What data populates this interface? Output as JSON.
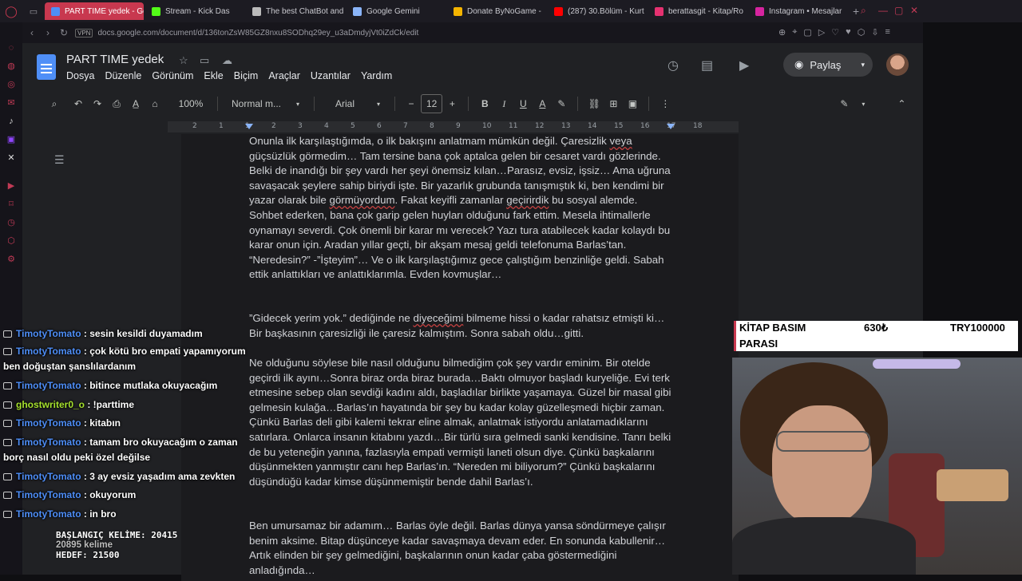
{
  "browser": {
    "tabs": [
      {
        "label": "PART TIME yedek - Goog",
        "color": "#4f8ff7",
        "active": true
      },
      {
        "label": "Stream - Kick Das",
        "color": "#53fc18",
        "active": false
      },
      {
        "label": "The best ChatBot and",
        "color": "#bbbbbb",
        "active": false
      },
      {
        "label": "Google Gemini",
        "color": "#8ab4f8",
        "active": false
      },
      {
        "label": "Donate ByNoGame -",
        "color": "#f4b400",
        "active": false
      },
      {
        "label": "(287) 30.Bölüm - Kurt",
        "color": "#ff0000",
        "active": false
      },
      {
        "label": "berattasgit - Kitap/Ro",
        "color": "#e53170",
        "active": false
      },
      {
        "label": "Instagram • Mesajlar",
        "color": "#d6249f",
        "active": false
      }
    ],
    "vpn": "VPN",
    "url": "docs.google.com/document/d/136tonZsW85GZ8nxu8SODhq29ey_u3aDmdyjVt0iZdCk/edit"
  },
  "docs": {
    "title": "PART TIME  yedek",
    "menus": [
      "Dosya",
      "Düzenle",
      "Görünüm",
      "Ekle",
      "Biçim",
      "Araçlar",
      "Uzantılar",
      "Yardım"
    ],
    "share_label": "Paylaş",
    "zoom": "100%",
    "style": "Normal m...",
    "font": "Arial",
    "font_size": "12",
    "ruler": [
      "2",
      "1",
      "1",
      "2",
      "3",
      "4",
      "5",
      "6",
      "7",
      "8",
      "9",
      "10",
      "11",
      "12",
      "13",
      "14",
      "15",
      "16",
      "17",
      "18"
    ]
  },
  "document": {
    "p1_parts": [
      {
        "t": "Onunla ilk karşılaştığımda, o ilk bakışını anlatmam mümkün değil. Çaresizlik ",
        "sq": false
      },
      {
        "t": "veya",
        "sq": true
      },
      {
        "t": " güçsüzlük görmedim… Tam tersine bana çok aptalca gelen bir cesaret vardı gözlerinde. Belki de inandığı bir şey vardı her şeyi önemsiz kılan…Parasız, evsiz, işsiz… Ama uğruna savaşacak şeylere sahip biriydi işte. Bir yazarlık grubunda tanışmıştık ki, ben kendimi bir yazar olarak bile ",
        "sq": false
      },
      {
        "t": "görmüyordum",
        "sq": true
      },
      {
        "t": ". Fakat keyifli zamanlar ",
        "sq": false
      },
      {
        "t": "geçirirdik",
        "sq": true
      },
      {
        "t": " bu sosyal alemde. Sohbet ederken, bana çok garip gelen huyları olduğunu fark ettim. Mesela ihtimallerle oynamayı severdi. Çok önemli bir karar mı verecek? Yazı tura atabilecek kadar kolaydı bu karar onun için. Aradan yıllar geçti, bir akşam mesaj geldi telefonuma Barlas’tan. “Neredesin?” -”İşteyim”… Ve o ilk karşılaştığımız gece çalıştığım benzinliğe geldi. Sabah ettik anlattıkları ve anlattıklarımla. Evden kovmuşlar…",
        "sq": false
      }
    ],
    "p2_parts": [
      {
        "t": "”Gidecek yerim yok.” dediğinde ne ",
        "sq": false
      },
      {
        "t": "diyeceğimi",
        "sq": true
      },
      {
        "t": " bilmeme hissi o kadar rahatsız etmişti ki… Bir başkasının çaresizliği ile çaresiz kalmıştım. Sonra sabah oldu…gitti.",
        "sq": false
      }
    ],
    "p3": "Ne olduğunu söylese bile nasıl olduğunu bilmediğim çok şey vardır eminim. Bir otelde geçirdi ilk ayını…Sonra biraz orda biraz burada…Baktı olmuyor başladı kuryeliğe. Evi terk etmesine sebep olan sevdiği kadını aldı, başladılar birlikte yaşamaya. Güzel bir masal gibi gelmesin kulağa…Barlas’ın hayatında bir şey bu kadar kolay güzelleşmedi hiçbir zaman. Çünkü Barlas deli gibi kalemi tekrar eline almak, anlatmak istiyordu anlatamadıklarını satırlara. Onlarca insanın kitabını yazdı…Bir türlü sıra gelmedi sanki kendisine. Tanrı belki de bu yeteneğin yanına, fazlasıyla empati vermişti laneti olsun diye. Çünkü başkalarını düşünmekten yanmıştır canı hep Barlas’ın. “Nereden mi biliyorum?” Çünkü başkalarını düşündüğü kadar kimse düşünmemiştir bende dahil Barlas’ı.",
    "p4": "Ben umursamaz bir adamım… Barlas öyle değil. Barlas dünya yansa söndürmeye çalışır benim aksime. Bitap düşünceye kadar savaşmaya devam eder. En sonunda kabullenir… Artık elinden bir şey gelmediğini, başkalarının onun kadar çaba göstermediğini anladığında…"
  },
  "chat": [
    {
      "user": "TimotyTomato",
      "msg": ": sesin kesildi duyamadım",
      "cls": "user"
    },
    {
      "user": "TimotyTomato",
      "msg": ": çok kötü bro empati yapamıyorum ben doğuştan şanslılardanım",
      "cls": "user"
    },
    {
      "user": "TimotyTomato",
      "msg": ": bitince mutlaka okuyacağım",
      "cls": "user"
    },
    {
      "user": "ghostwriter0_o",
      "msg": ": !parttime",
      "cls": "user2"
    },
    {
      "user": "TimotyTomato",
      "msg": ": kitabın",
      "cls": "user"
    },
    {
      "user": "TimotyTomato",
      "msg": ": tamam bro okuyacağım o zaman borç nasıl oldu peki özel değilse",
      "cls": "user"
    },
    {
      "user": "TimotyTomato",
      "msg": ": 3 ay evsiz yaşadım ama zevkten",
      "cls": "user"
    },
    {
      "user": "TimotyTomato",
      "msg": ": okuyorum",
      "cls": "user"
    },
    {
      "user": "TimotyTomato",
      "msg": ": in bro",
      "cls": "user"
    }
  ],
  "counter": {
    "start": "BAŞLANGIÇ KELİME: 20415",
    "words": "20895 kelime",
    "goal": "HEDEF: 21500"
  },
  "goal_box": {
    "label1": "KİTAP BASIM",
    "label2": "PARASI",
    "amount": "630₺",
    "target": "TRY100000"
  }
}
